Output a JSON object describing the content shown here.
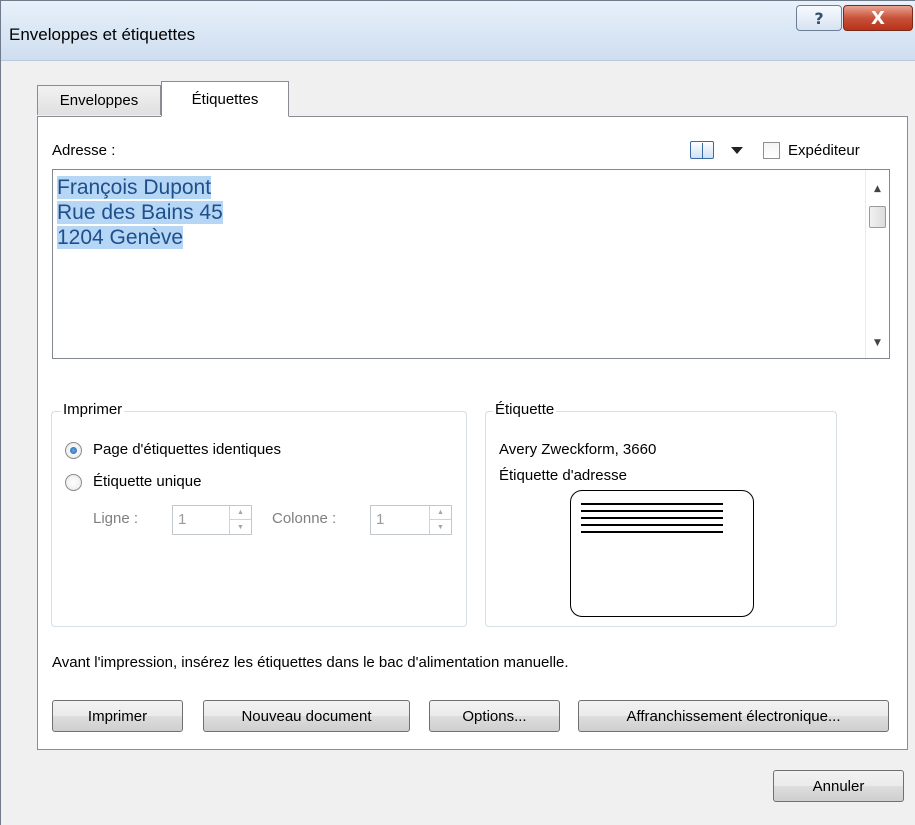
{
  "window": {
    "title": "Enveloppes et étiquettes",
    "help_label": "?",
    "close_label": "X"
  },
  "tabs": [
    {
      "label": "Enveloppes",
      "selected": false
    },
    {
      "label": "Étiquettes",
      "selected": true
    }
  ],
  "address": {
    "label": "Adresse :",
    "lines": [
      "François Dupont ",
      "Rue des Bains 45 ",
      "1204 Genève"
    ],
    "address_book_icon": "address-book-icon",
    "expediteur_label": "Expéditeur",
    "expediteur_checked": false
  },
  "print_group": {
    "legend": "Imprimer",
    "option_full_page": "Page d'étiquettes identiques",
    "option_single": "Étiquette unique",
    "selected": "full_page",
    "row_label": "Ligne :",
    "row_value": "1",
    "column_label": "Colonne :",
    "column_value": "1"
  },
  "label_group": {
    "legend": "Étiquette",
    "vendor": "Avery Zweckform, 3660",
    "type": "Étiquette d'adresse"
  },
  "notice": "Avant l'impression, insérez les étiquettes dans le bac d'alimentation manuelle.",
  "buttons": {
    "print": "Imprimer",
    "new_document": "Nouveau document",
    "options": "Options...",
    "electronic_postage": "Affranchissement électronique...",
    "cancel": "Annuler"
  }
}
